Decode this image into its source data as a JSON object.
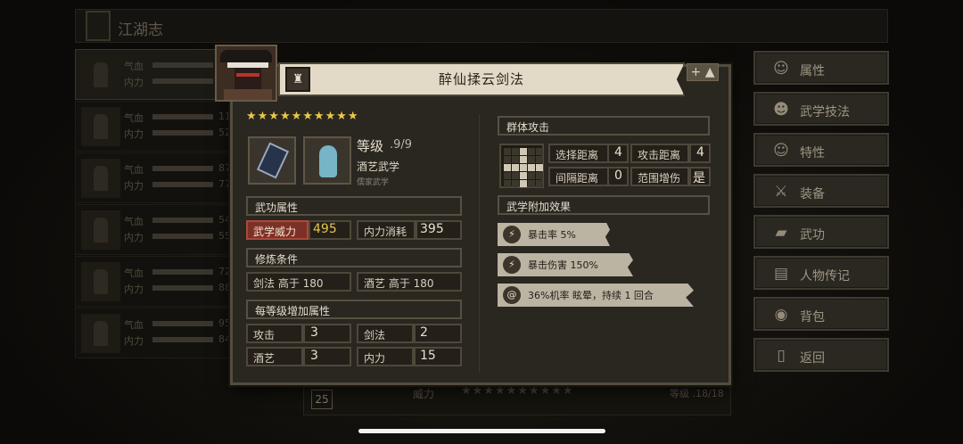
{
  "header": {
    "title": "江湖志"
  },
  "roster": [
    {
      "hp_label": "气血",
      "mp_label": "内力",
      "hp_val": "",
      "mp_val": ""
    },
    {
      "hp_label": "气血",
      "mp_label": "内力",
      "hp_val": "11",
      "mp_val": "52"
    },
    {
      "hp_label": "气血",
      "mp_label": "内力",
      "hp_val": "87",
      "mp_val": "77"
    },
    {
      "hp_label": "气血",
      "mp_label": "内力",
      "hp_val": "54",
      "mp_val": "55"
    },
    {
      "hp_label": "气血",
      "mp_label": "内力",
      "hp_val": "72",
      "mp_val": "88"
    },
    {
      "hp_label": "气血",
      "mp_label": "内力",
      "hp_val": "95",
      "mp_val": "84"
    }
  ],
  "side_menu": [
    {
      "label": "属性",
      "icon": "person-icon",
      "glyph": "☺"
    },
    {
      "label": "武学技法",
      "icon": "skill-icon",
      "glyph": "☻"
    },
    {
      "label": "特性",
      "icon": "trait-icon",
      "glyph": "☺"
    },
    {
      "label": "装备",
      "icon": "sword-icon",
      "glyph": "⚔"
    },
    {
      "label": "武功",
      "icon": "book-icon",
      "glyph": "▰"
    },
    {
      "label": "人物传记",
      "icon": "scroll-icon",
      "glyph": "▤"
    },
    {
      "label": "背包",
      "icon": "bag-icon",
      "glyph": "◉"
    },
    {
      "label": "返回",
      "icon": "door-icon",
      "glyph": "▯"
    }
  ],
  "dialog": {
    "title": "醉仙揉云剑法",
    "stars": "★★★★★★★★★★",
    "level_label": "等级",
    "level_value": ".9/9",
    "school": "酒艺武学",
    "school_sub": "儒家武学",
    "attr_section": "武功属性",
    "power_label": "武学威力",
    "power_value": "495",
    "mana_label": "内力消耗",
    "mana_value": "395",
    "req_section": "修炼条件",
    "req1": "剑法 高于 180",
    "req2": "酒艺 高于 180",
    "bonus_section": "每等级增加属性",
    "bonus": [
      {
        "label": "攻击",
        "value": "3"
      },
      {
        "label": "剑法",
        "value": "2"
      },
      {
        "label": "酒艺",
        "value": "3"
      },
      {
        "label": "内力",
        "value": "15"
      }
    ],
    "attack_type": "群体攻击",
    "select_range_label": "选择距离",
    "select_range_value": "4",
    "attack_range_label": "攻击距离",
    "attack_range_value": "4",
    "interval_label": "间隔距离",
    "interval_value": "0",
    "aoe_label": "范围增伤",
    "aoe_value": "是",
    "effects_section": "武学附加效果",
    "effects": [
      {
        "text": "暴击率 5%",
        "icon": "lightning-icon"
      },
      {
        "text": "暴击伤害 150%",
        "icon": "lightning-icon"
      },
      {
        "text": "36%机率 眩晕，持续 1 回合",
        "icon": "spiral-icon"
      }
    ]
  },
  "peek": {
    "badge": "25",
    "label": "威力",
    "stars": "★★★★★★★★★★",
    "level": "等级 .18/18"
  },
  "colors": {
    "accent_gold": "#e8c84b",
    "highlight_red": "#7d3126",
    "school_blue": "#77b4c6"
  }
}
